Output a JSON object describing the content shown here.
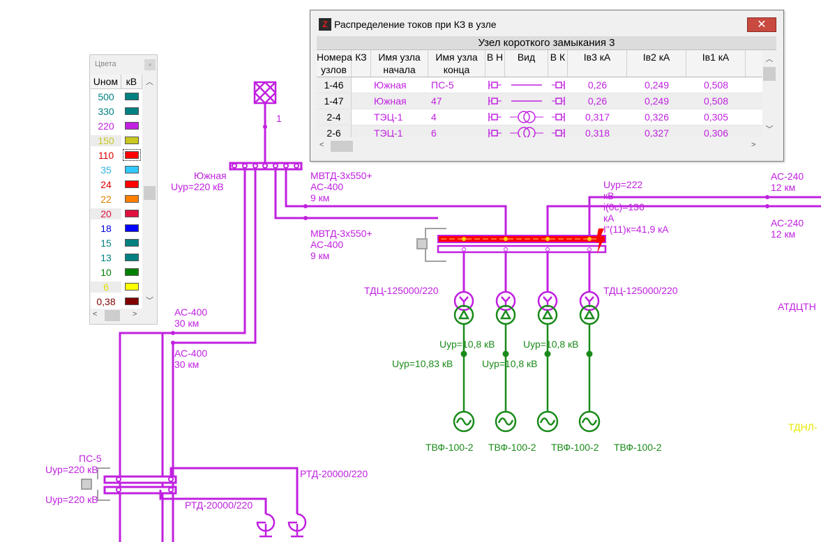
{
  "colors_panel": {
    "title": "Цвета",
    "close_glyph": "×",
    "headers": [
      "Uном",
      "кВ"
    ],
    "rows": [
      {
        "value": "500",
        "text_color": "#008080",
        "swatch": "#008080"
      },
      {
        "value": "330",
        "text_color": "#008080",
        "swatch": "#008080"
      },
      {
        "value": "220",
        "text_color": "#c020e0",
        "swatch": "#c020e0"
      },
      {
        "value": "150",
        "text_color": "#c8c820",
        "swatch": "#c8c820"
      },
      {
        "value": "110",
        "text_color": "#e00000",
        "swatch": "#ff0000",
        "selected": true
      },
      {
        "value": "35",
        "text_color": "#30b0e0",
        "swatch": "#30c8ff"
      },
      {
        "value": "24",
        "text_color": "#e00000",
        "swatch": "#ff0000"
      },
      {
        "value": "22",
        "text_color": "#e08000",
        "swatch": "#ff8000"
      },
      {
        "value": "20",
        "text_color": "#e01040",
        "swatch": "#e01040"
      },
      {
        "value": "18",
        "text_color": "#0000e0",
        "swatch": "#0000ff"
      },
      {
        "value": "15",
        "text_color": "#008080",
        "swatch": "#008080"
      },
      {
        "value": "13",
        "text_color": "#008080",
        "swatch": "#008080"
      },
      {
        "value": "10",
        "text_color": "#008000",
        "swatch": "#008000"
      },
      {
        "value": "6",
        "text_color": "#e0e000",
        "swatch": "#ffff00"
      },
      {
        "value": "0,38",
        "text_color": "#800000",
        "swatch": "#800000"
      }
    ]
  },
  "fault_window": {
    "title": "Распределение токов при КЗ в узле",
    "close_glyph": "✕",
    "caption": "Узел короткого замыкания 3",
    "columns": [
      "Номера узлов",
      "КЗ",
      "Имя узла начала",
      "Имя узла конца",
      "В Н",
      "Вид",
      "В К",
      "Iв3 кА",
      "Iв2 кА",
      "Iв1 кА"
    ],
    "rows": [
      {
        "nodes": "1-46",
        "kz": "",
        "start": "Южная",
        "end": "ПС-5",
        "kind": "line",
        "i3": "0,26",
        "i2": "0,249",
        "i1": "0,508"
      },
      {
        "nodes": "1-47",
        "kz": "",
        "start": "Южная",
        "end": "47",
        "kind": "line",
        "i3": "0,26",
        "i2": "0,249",
        "i1": "0,508"
      },
      {
        "nodes": "2-4",
        "kz": "",
        "start": "ТЭЦ-1",
        "end": "4",
        "kind": "transformer",
        "i3": "0,317",
        "i2": "0,326",
        "i1": "0,305"
      },
      {
        "nodes": "2-6",
        "kz": "",
        "start": "ТЭЦ-1",
        "end": "6",
        "kind": "transformer",
        "i3": "0,318",
        "i2": "0,327",
        "i1": "0,306"
      }
    ]
  },
  "diagram": {
    "labels": {
      "node1": "1",
      "yuzhnaya": "Южная",
      "yuzhnaya_u": "Uур=220 кВ",
      "mvtd1_a": "МВТД-3x550+",
      "mvtd1_b": "АС-400",
      "mvtd1_c": "9 км",
      "mvtd2_a": "МВТД-3x550+",
      "mvtd2_b": "АС-400",
      "mvtd2_c": "9 км",
      "bus_u_a": "Uур=222",
      "bus_u_b": "кВ",
      "bus_i_a": "i(0c)=136",
      "bus_i_b": "кА",
      "bus_ik": "I\"(11)к=41,9 кА",
      "ac240_1a": "АС-240",
      "ac240_1b": "12 км",
      "ac240_2a": "АС-240",
      "ac240_2b": "12 км",
      "tdc_left": "ТДЦ-125000/220",
      "tdc_right": "ТДЦ-125000/220",
      "atdctn": "АТДЦТН",
      "tdnl": "ТДНЛ-",
      "ac400_1a": "АС-400",
      "ac400_1b": "30 км",
      "ac400_2a": "АС-400",
      "ac400_2b": "30 км",
      "gen_u1": "Uур=10,8 кВ",
      "gen_u2": "Uур=10,8 кВ",
      "gen_u3": "Uур=10,83 кВ",
      "gen_u4": "Uур=10,8 кВ",
      "gen1": "ТВФ-100-2",
      "gen2": "ТВФ-100-2",
      "gen3": "ТВФ-100-2",
      "gen4": "ТВФ-100-2",
      "ps5": "ПС-5",
      "ps5_u1": "Uур=220 кВ",
      "ps5_u2": "Uур=220 кВ",
      "rtd1": "РТД-20000/220",
      "rtd2": "РТД-20000/220"
    },
    "colors": {
      "v220": "#c020e0",
      "v10": "#1a8a1a",
      "v6": "#e8e800",
      "fault_bus": "#ff0000",
      "disconnected": "#a0a0a0"
    }
  }
}
